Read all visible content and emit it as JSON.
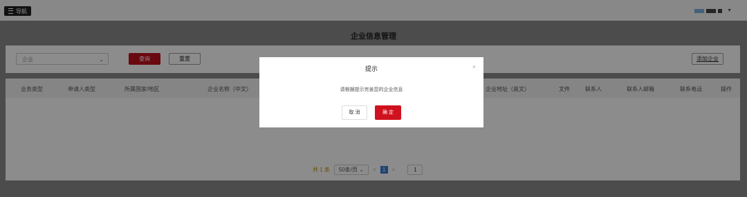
{
  "topbar": {
    "nav_label": "导航"
  },
  "page": {
    "title": "企业信息管理"
  },
  "filters": {
    "select_value": "企业",
    "query_label": "查询",
    "reset_label": "重置",
    "add_label": "添加企业"
  },
  "table": {
    "columns": [
      "业务类型",
      "申请人类型",
      "所属国家/地区",
      "企业名称（中文）",
      "企业地址（英文）",
      "文件",
      "联系人",
      "联系人邮箱",
      "联系电话",
      "操作"
    ]
  },
  "pagination": {
    "total": "共 1 条",
    "page_size": "50条/页",
    "current_page": "1",
    "prev": "<",
    "next": ">",
    "jump_value": "1"
  },
  "dialog": {
    "title": "提示",
    "close": "×",
    "message": "请根据提示完善您的企业信息",
    "cancel_label": "取 消",
    "ok_label": "确 定"
  },
  "colors": {
    "primary_red": "#d0121e",
    "overlay": "rgba(0,0,0,0.45)"
  }
}
